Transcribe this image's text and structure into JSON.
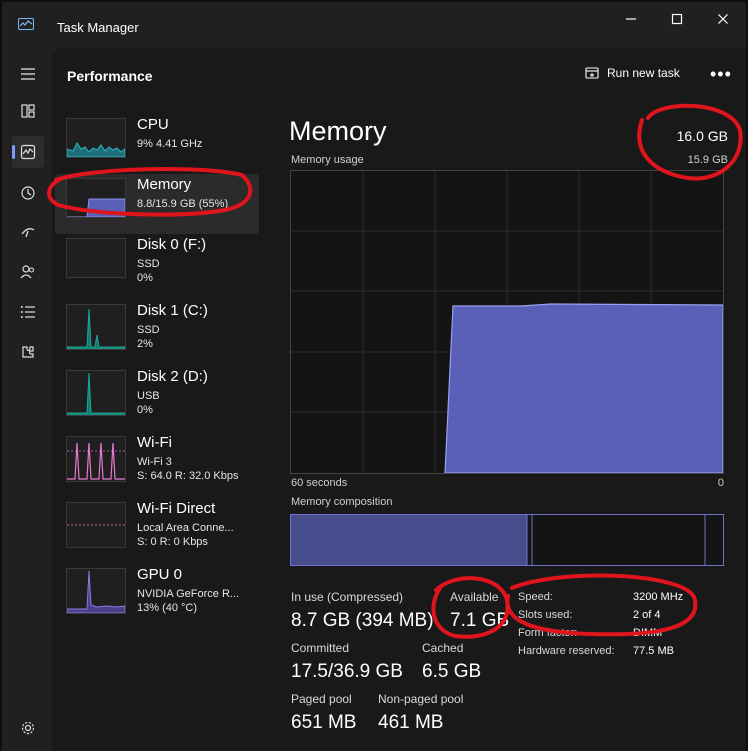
{
  "window": {
    "title": "Task Manager"
  },
  "header": {
    "section": "Performance",
    "run_task": "Run new task",
    "more": "•••"
  },
  "icons": {
    "app": "task-manager-icon",
    "hamburger": "menu-icon",
    "processes": "processes-icon",
    "performance": "performance-icon",
    "history": "history-icon",
    "startup": "startup-icon",
    "users": "users-icon",
    "details": "details-icon",
    "services": "services-icon",
    "settings": "gear-icon"
  },
  "sidebar": {
    "items": [
      {
        "name": "CPU",
        "line1": "9%  4.41 GHz",
        "line2": ""
      },
      {
        "name": "Memory",
        "line1": "8.8/15.9 GB (55%)",
        "line2": ""
      },
      {
        "name": "Disk 0 (F:)",
        "line1": "SSD",
        "line2": "0%"
      },
      {
        "name": "Disk 1 (C:)",
        "line1": "SSD",
        "line2": "2%"
      },
      {
        "name": "Disk 2 (D:)",
        "line1": "USB",
        "line2": "0%"
      },
      {
        "name": "Wi-Fi",
        "line1": "Wi-Fi 3",
        "line2": "S: 64.0  R: 32.0 Kbps"
      },
      {
        "name": "Wi-Fi Direct",
        "line1": "Local Area Conne...",
        "line2": "S: 0  R: 0 Kbps"
      },
      {
        "name": "GPU 0",
        "line1": "NVIDIA GeForce R...",
        "line2": "13% (40 °C)"
      }
    ]
  },
  "memory": {
    "title": "Memory",
    "total": "16.0 GB",
    "usage_label": "Memory usage",
    "usage_max": "15.9 GB",
    "axis_left": "60 seconds",
    "axis_right": "0",
    "composition_label": "Memory composition",
    "in_use_label": "In use (Compressed)",
    "in_use_value": "8.7 GB (394 MB)",
    "available_label": "Available",
    "available_value": "7.1 GB",
    "committed_label": "Committed",
    "committed_value": "17.5/36.9 GB",
    "cached_label": "Cached",
    "cached_value": "6.5 GB",
    "paged_label": "Paged pool",
    "paged_value": "651 MB",
    "nonpaged_label": "Non-paged pool",
    "nonpaged_value": "461 MB",
    "specs": [
      {
        "label": "Speed:",
        "value": "3200 MHz"
      },
      {
        "label": "Slots used:",
        "value": "2 of 4"
      },
      {
        "label": "Form factor:",
        "value": "DIMM"
      },
      {
        "label": "Hardware reserved:",
        "value": "77.5 MB"
      }
    ]
  },
  "colors": {
    "accent": "#7a9bff",
    "memory_fill": "#5a60b8",
    "cpu": "#2bb5c4",
    "disk": "#1fa69a",
    "wifi": "#e87ad2",
    "gpu": "#8f7bd9",
    "annotation": "#e0141c"
  }
}
